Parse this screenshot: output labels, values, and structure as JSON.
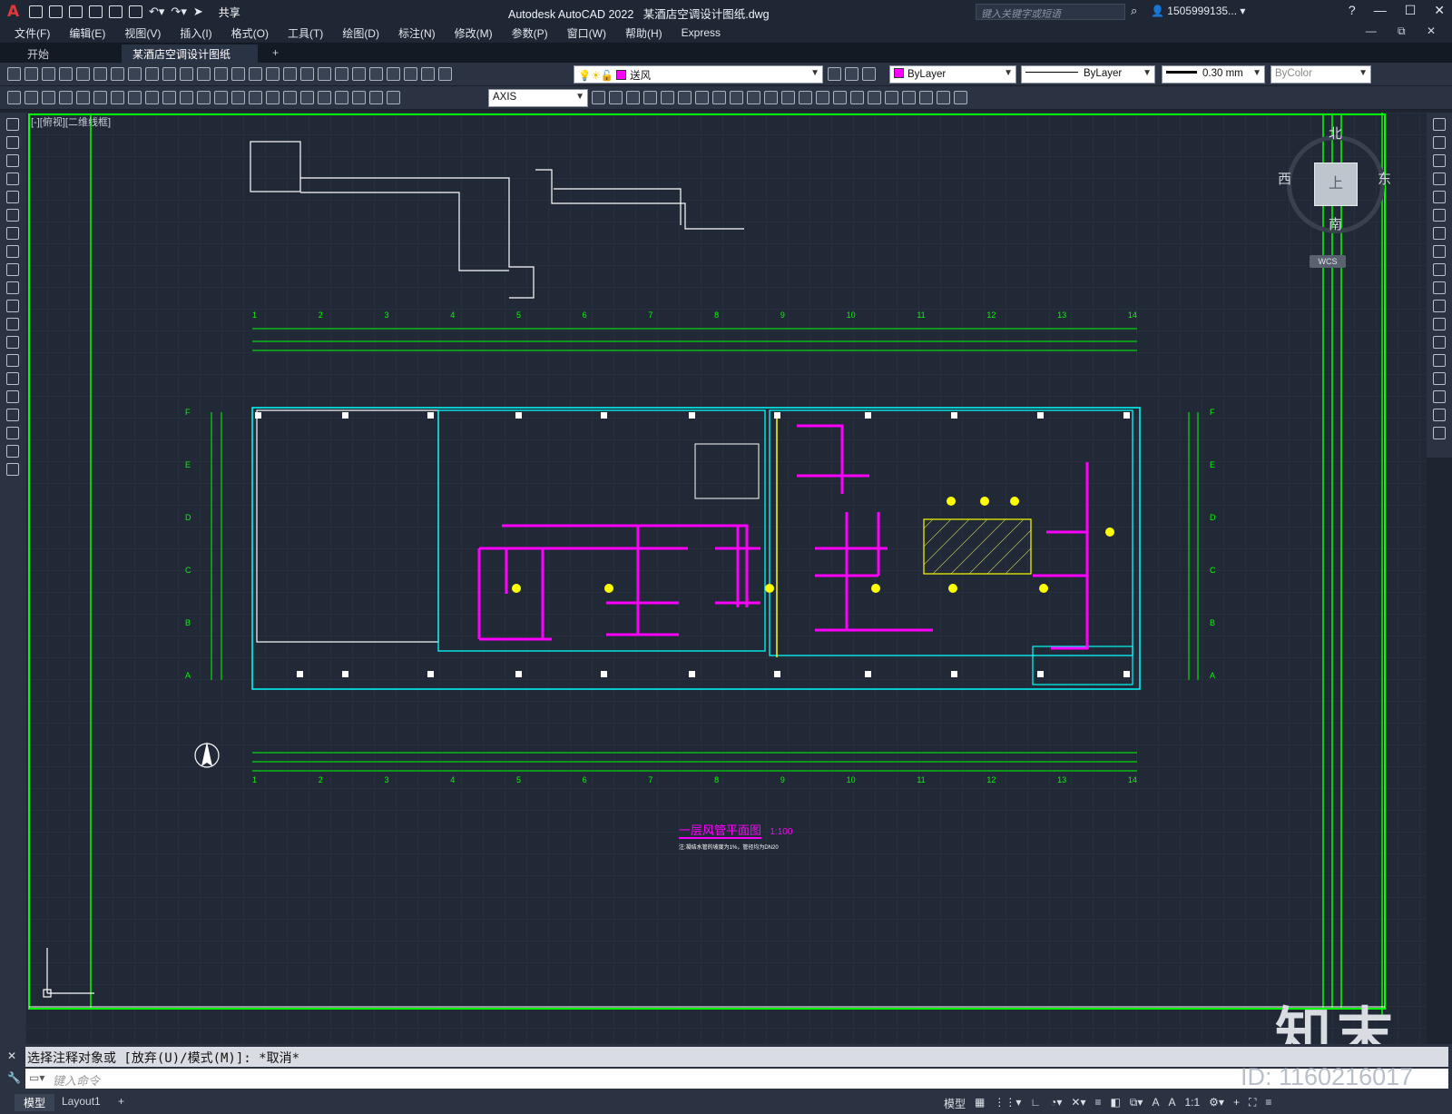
{
  "titlebar": {
    "app": "Autodesk AutoCAD 2022",
    "file": "某酒店空调设计图纸.dwg",
    "share": "共享",
    "search_placeholder": "键入关键字或短语",
    "user": "1505999135...",
    "logo": "A"
  },
  "menu": [
    "文件(F)",
    "编辑(E)",
    "视图(V)",
    "插入(I)",
    "格式(O)",
    "工具(T)",
    "绘图(D)",
    "标注(N)",
    "修改(M)",
    "参数(P)",
    "窗口(W)",
    "帮助(H)",
    "Express"
  ],
  "tabs": {
    "start": "开始",
    "doc": "某酒店空调设计图纸*"
  },
  "toolbar": {
    "layer": "送风",
    "color": "ByLayer",
    "linetype": "ByLayer",
    "lineweight": "0.30 mm",
    "plotstyle": "ByColor",
    "dimstyle": "AXIS"
  },
  "viewport": {
    "label": "[-][俯视][二维线框]",
    "viewcube": {
      "top": "上",
      "north": "北",
      "south": "南",
      "east": "东",
      "west": "西",
      "wcs": "WCS"
    }
  },
  "drawing": {
    "title": "一层风管平面图",
    "scale": "1:100",
    "note": "注:凝结水管的坡度为1%，管径均为DN20",
    "axes_top": [
      "1",
      "2",
      "3",
      "4",
      "5",
      "6",
      "7",
      "8",
      "9",
      "10",
      "11",
      "12",
      "13",
      "14"
    ],
    "axes_side": [
      "F",
      "E",
      "D",
      "C",
      "B",
      "A"
    ]
  },
  "command": {
    "history": "选择注释对象或 [放弃(U)/模式(M)]: *取消*",
    "placeholder": "键入命令"
  },
  "status": {
    "tab_model": "模型",
    "tab_layout": "Layout1",
    "model_label": "模型",
    "scale": "1:1"
  },
  "watermark": {
    "logo": "知末",
    "id": "ID: 1160216017"
  },
  "colors": {
    "canvas": "#212836",
    "duct": "#ff00ff",
    "wall": "#00ffff",
    "axis": "#00ff00",
    "line": "#ffffff"
  }
}
